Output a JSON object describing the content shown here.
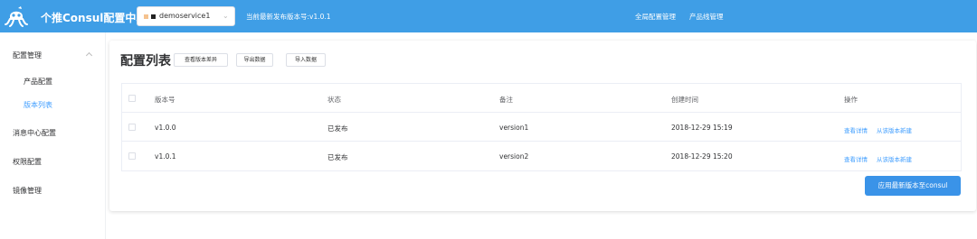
{
  "header": {
    "app_title": "个推Consul配置中心",
    "service_select": "demoservice1",
    "latest_version": "当前最新发布版本号:v1.0.1",
    "nav": [
      "全局配置管理",
      "产品线管理"
    ]
  },
  "sidebar": {
    "items": [
      {
        "label": "配置管理",
        "expanded": true
      },
      {
        "label": "产品配置"
      },
      {
        "label": "版本列表",
        "active": true
      },
      {
        "label": "消息中心配置"
      },
      {
        "label": "权限配置"
      },
      {
        "label": "镜像管理"
      }
    ]
  },
  "main": {
    "title": "配置列表",
    "buttons": {
      "diff": "查看版本差异",
      "export": "导出数据",
      "import": "导入数据"
    },
    "table": {
      "columns": [
        "版本号",
        "状态",
        "备注",
        "创建时间",
        "操作"
      ],
      "rows": [
        {
          "version": "v1.0.0",
          "status": "已发布",
          "note": "version1",
          "created": "2018-12-29 15:19",
          "action_view": "查看详情",
          "action_new": "从该版本新建"
        },
        {
          "version": "v1.0.1",
          "status": "已发布",
          "note": "version2",
          "created": "2018-12-29 15:20",
          "action_view": "查看详情",
          "action_new": "从该版本新建"
        }
      ]
    },
    "apply_button": "应用最新版本至consul"
  },
  "colors": {
    "header": "#3f9ee6",
    "accent": "#409eff",
    "apply_button": "#3a93e8"
  }
}
